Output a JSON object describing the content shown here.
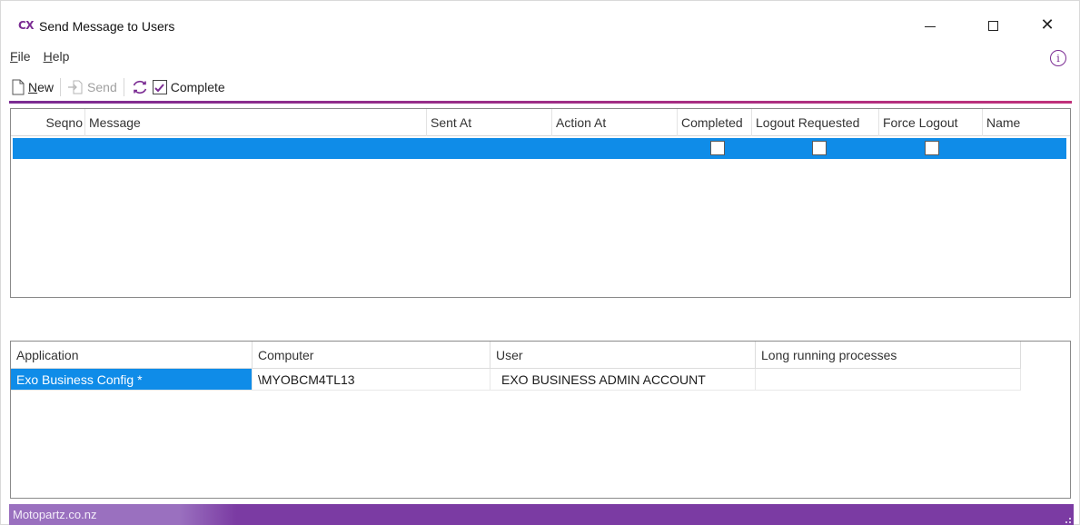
{
  "window": {
    "logo": "CX",
    "title": "Send Message to Users",
    "minimize_icon": "minimize-icon",
    "maximize_icon": "maximize-icon",
    "close_icon": "close-icon"
  },
  "menu": {
    "items": [
      {
        "accel": "F",
        "rest": "ile"
      },
      {
        "accel": "H",
        "rest": "elp"
      }
    ],
    "info_icon": "i"
  },
  "toolbar": {
    "new_accel": "N",
    "new_rest": "ew",
    "send_label": "Send",
    "complete_label": "Complete",
    "complete_checked": true
  },
  "messages_grid": {
    "columns": [
      "Seqno",
      "Message",
      "Sent At",
      "Action At",
      "Completed",
      "Logout Requested",
      "Force Logout",
      "Name"
    ],
    "rows": [
      {
        "seqno": "",
        "message": "",
        "sent_at": "",
        "action_at": "",
        "completed": false,
        "logout_requested": false,
        "force_logout": false,
        "name": ""
      }
    ]
  },
  "sessions_grid": {
    "columns": [
      "Application",
      "Computer",
      "User",
      "Long running processes"
    ],
    "rows": [
      [
        "Exo Business Config *",
        "\\MYOBCM4TL13",
        "EXO BUSINESS ADMIN ACCOUNT",
        ""
      ]
    ]
  },
  "status": {
    "company": "Motopartz.co.nz"
  },
  "colors": {
    "accent": "#7b2c93",
    "selection": "#0f8ce8",
    "statusbar": "#7b3ba3"
  }
}
